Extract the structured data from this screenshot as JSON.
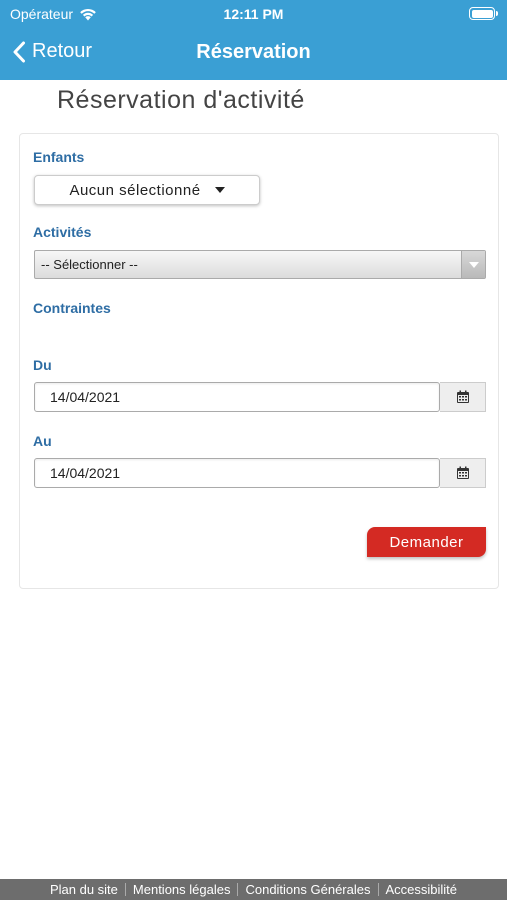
{
  "status": {
    "carrier": "Opérateur",
    "time": "12:11 PM"
  },
  "nav": {
    "back_label": "Retour",
    "title": "Réservation"
  },
  "page": {
    "heading": "Réservation d'activité"
  },
  "form": {
    "children_label": "Enfants",
    "children_value": "Aucun sélectionné",
    "activities_label": "Activités",
    "activities_value": "-- Sélectionner --",
    "constraints_label": "Contraintes",
    "from_label": "Du",
    "from_value": "14/04/2021",
    "to_label": "Au",
    "to_value": "14/04/2021",
    "submit_label": "Demander"
  },
  "footer": {
    "links": [
      "Plan du site",
      "Mentions légales",
      "Conditions Générales",
      "Accessibilité"
    ]
  },
  "colors": {
    "header": "#3a9fd4",
    "label": "#2e6da4",
    "submit": "#d42a23",
    "footer": "#6d6d6d"
  }
}
